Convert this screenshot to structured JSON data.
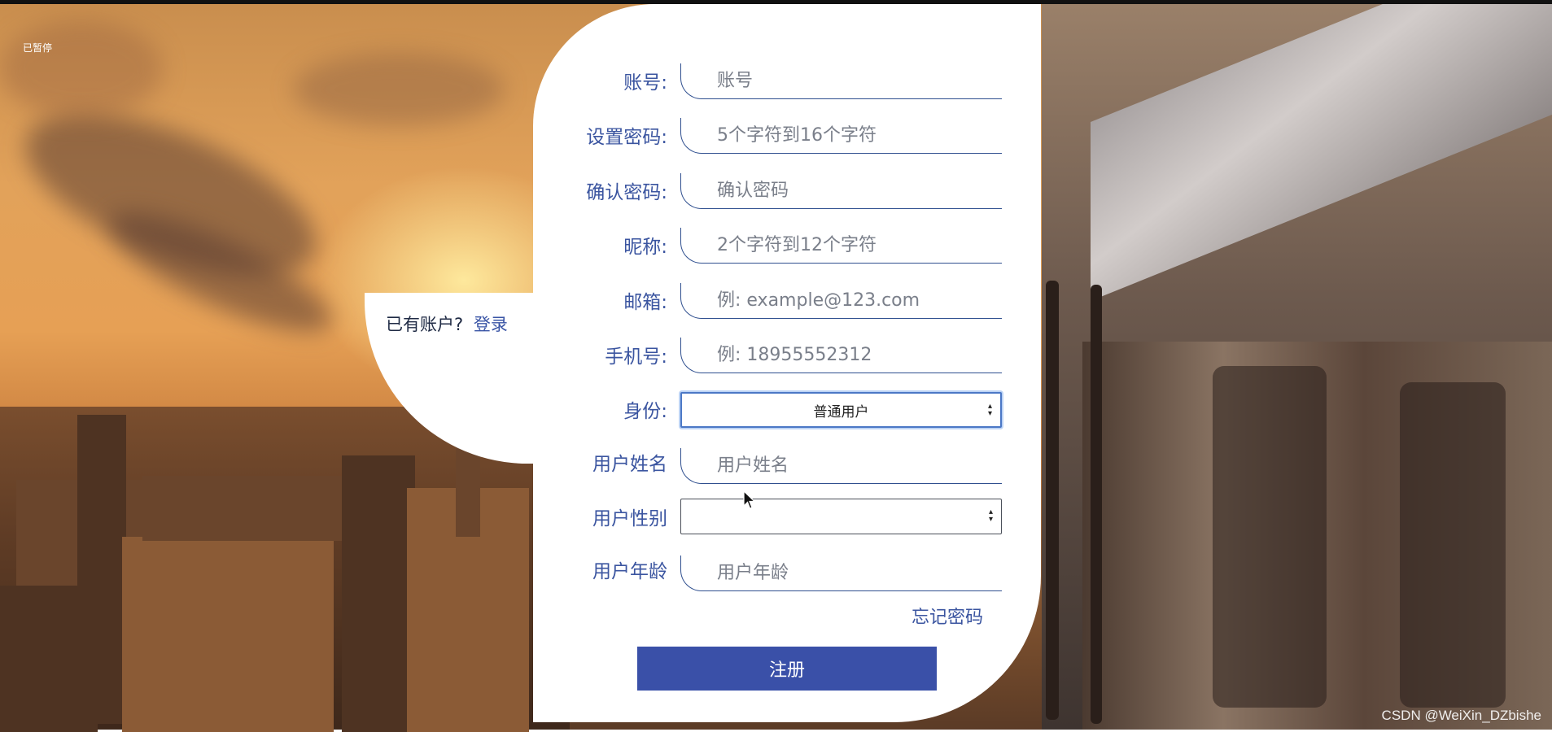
{
  "status": "已暂停",
  "login_prompt": {
    "text": "已有账户?",
    "link": "登录"
  },
  "fields": [
    {
      "label": "账号:",
      "placeholder": "账号"
    },
    {
      "label": "设置密码:",
      "placeholder": "5个字符到16个字符"
    },
    {
      "label": "确认密码:",
      "placeholder": "确认密码"
    },
    {
      "label": "昵称:",
      "placeholder": "2个字符到12个字符"
    },
    {
      "label": "邮箱:",
      "placeholder": "例: example@123.com"
    },
    {
      "label": "手机号:",
      "placeholder": "例: 18955552312"
    }
  ],
  "role": {
    "label": "身份:",
    "selected": "普通用户"
  },
  "user_name": {
    "label": "用户姓名",
    "placeholder": "用户姓名"
  },
  "user_gender": {
    "label": "用户性别",
    "selected": ""
  },
  "user_age": {
    "label": "用户年龄",
    "placeholder": "用户年龄"
  },
  "forgot_password": "忘记密码",
  "submit_label": "注册",
  "watermark": "CSDN @WeiXin_DZbishe",
  "colors": {
    "accent": "#3a50a8",
    "label": "#3b55a0"
  }
}
